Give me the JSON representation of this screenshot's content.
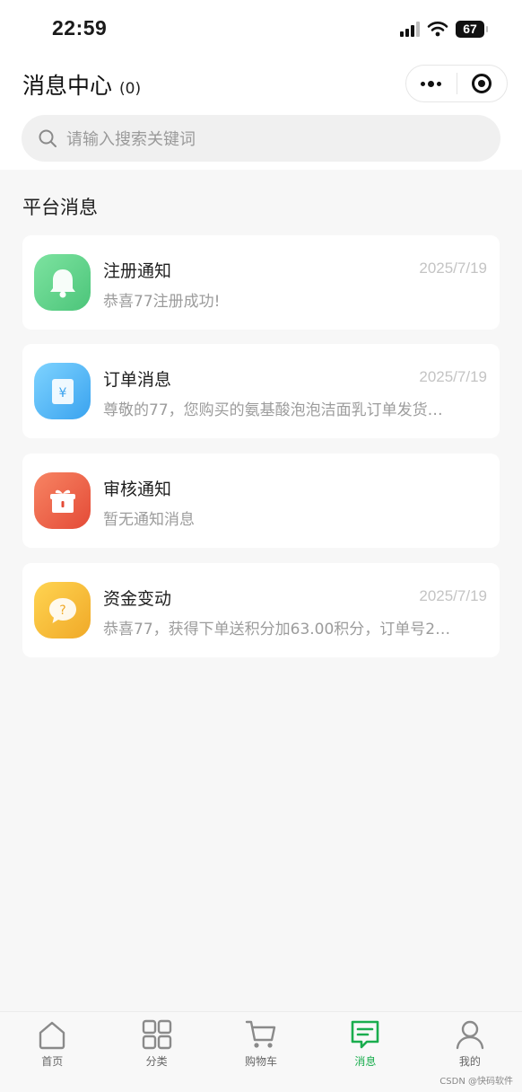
{
  "status_bar": {
    "time": "22:59",
    "battery": "67"
  },
  "header": {
    "title": "消息中心",
    "count": "(0)"
  },
  "search": {
    "placeholder": "请输入搜索关键词"
  },
  "section": {
    "title": "平台消息"
  },
  "messages": [
    {
      "title": "注册通知",
      "date": "2025/7/19",
      "preview": "恭喜77注册成功!",
      "icon": "bell-icon",
      "color": "#5fd28a"
    },
    {
      "title": "订单消息",
      "date": "2025/7/19",
      "preview": "尊敬的77，您购买的氨基酸泡泡洁面乳订单发货…",
      "icon": "receipt-yuan-icon",
      "color": "#56b9f5"
    },
    {
      "title": "审核通知",
      "date": "",
      "preview": "暂无通知消息",
      "icon": "gift-icon",
      "color": "#ef6548"
    },
    {
      "title": "资金变动",
      "date": "2025/7/19",
      "preview": "恭喜77，获得下单送积分加63.00积分，订单号2…",
      "icon": "question-bubble-icon",
      "color": "#f6bf35"
    }
  ],
  "tabbar": [
    {
      "label": "首页",
      "icon": "home-icon"
    },
    {
      "label": "分类",
      "icon": "grid-icon"
    },
    {
      "label": "购物车",
      "icon": "cart-icon"
    },
    {
      "label": "消息",
      "icon": "message-icon",
      "active": true
    },
    {
      "label": "我的",
      "icon": "user-icon"
    }
  ],
  "colors": {
    "accent": "#1aad4e"
  },
  "watermark": "CSDN @快码软件"
}
